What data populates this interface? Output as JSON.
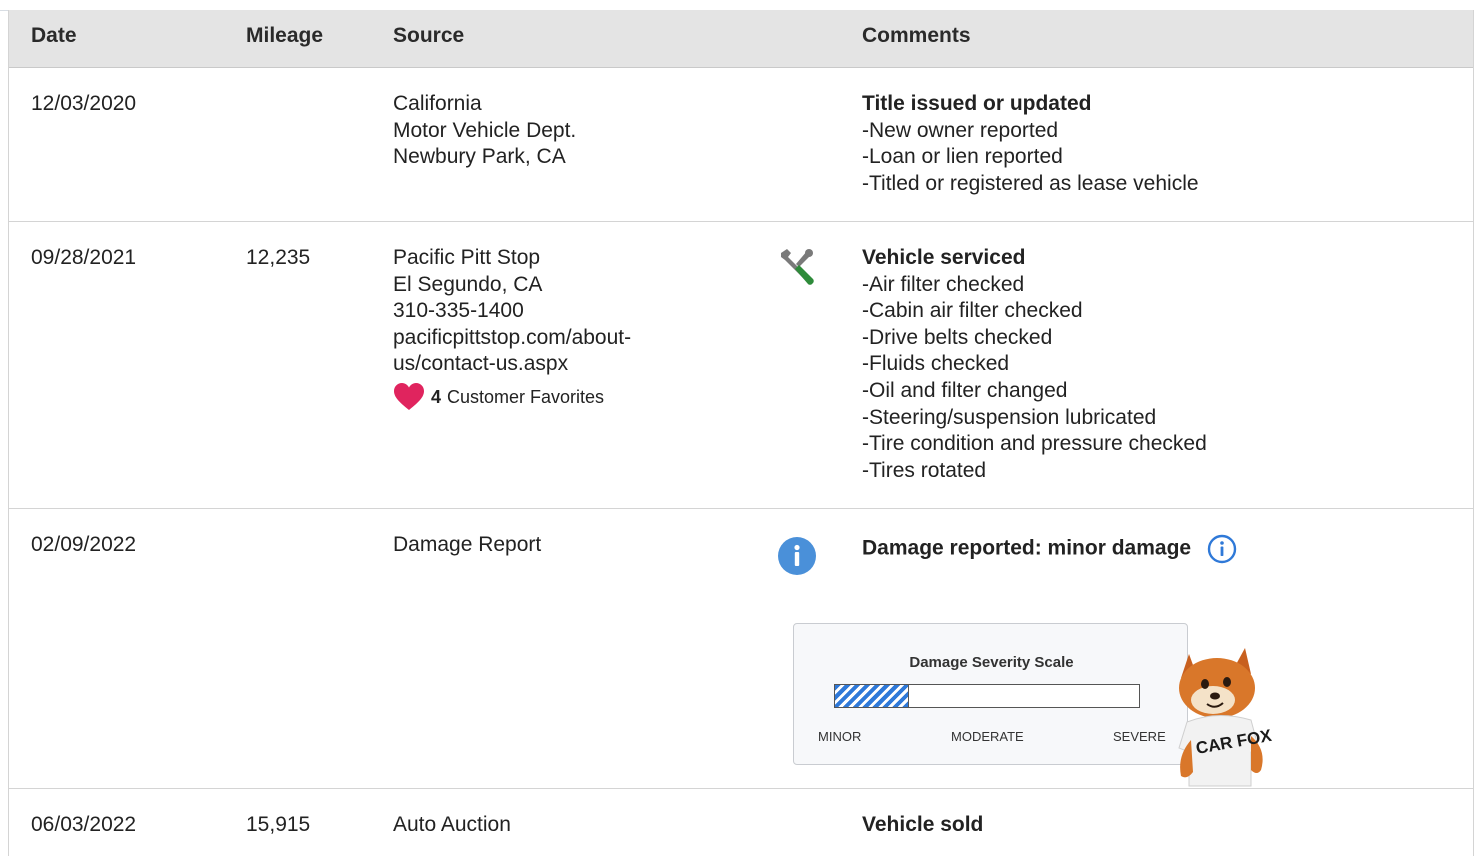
{
  "columns": {
    "date": "Date",
    "mileage": "Mileage",
    "source": "Source",
    "comments": "Comments"
  },
  "records": [
    {
      "date": "12/03/2020",
      "mileage": "",
      "source": [
        "California",
        "Motor Vehicle Dept.",
        "Newbury Park, CA"
      ],
      "comment_title": "Title issued or updated",
      "comment_items": [
        "New owner reported",
        "Loan or lien reported",
        "Titled or registered as lease vehicle"
      ]
    },
    {
      "date": "09/28/2021",
      "mileage": "12,235",
      "source": [
        "Pacific Pitt Stop",
        "El Segundo, CA",
        "310-335-1400",
        "pacificpittstop.com/about-",
        "us/contact-us.aspx"
      ],
      "favorites_count": "4",
      "favorites_label": "Customer Favorites",
      "icon": "service-tools-icon",
      "comment_title": "Vehicle serviced",
      "comment_items": [
        "Air filter checked",
        "Cabin air filter checked",
        "Drive belts checked",
        "Fluids checked",
        "Oil and filter changed",
        "Steering/suspension lubricated",
        "Tire condition and pressure checked",
        "Tires rotated"
      ]
    },
    {
      "date": "02/09/2022",
      "mileage": "",
      "source": [
        "Damage Report"
      ],
      "icon": "info-icon",
      "comment_title": "Damage reported: minor damage",
      "severity_scale": {
        "title": "Damage Severity Scale",
        "labels": [
          "MINOR",
          "MODERATE",
          "SEVERE"
        ],
        "level_fraction": 0.24,
        "fill_color": "#2f79d8"
      },
      "mascot_shirt_text": "CAR FOX"
    },
    {
      "date": "06/03/2022",
      "mileage": "15,915",
      "source": [
        "Auto Auction"
      ],
      "comment_title": "Vehicle sold",
      "comment_items": []
    }
  ],
  "colors": {
    "header_bg": "#e4e4e4",
    "heart": "#e0245e",
    "info": "#4a90d9",
    "tools_green": "#2e8b3a"
  }
}
